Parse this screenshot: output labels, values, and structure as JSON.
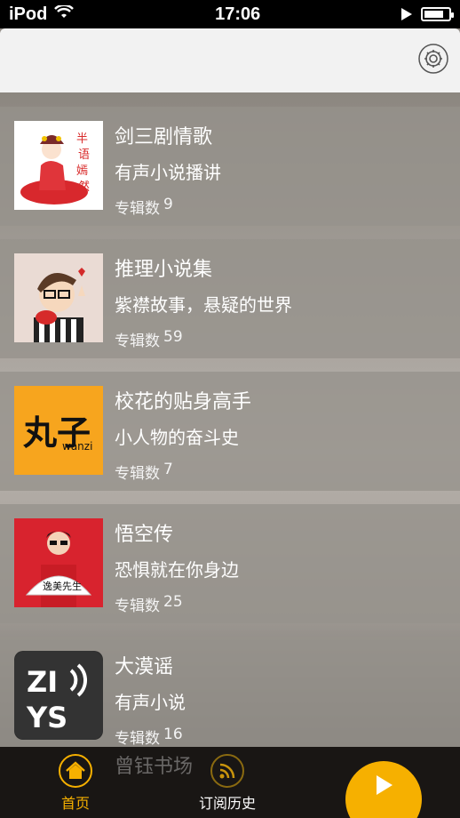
{
  "status_bar": {
    "carrier": "iPod",
    "time": "17:06"
  },
  "header": {
    "settings_icon": "gear-icon"
  },
  "items": [
    {
      "title": "剑三剧情歌",
      "subtitle": "有声小说播讲",
      "count_label": "专辑数",
      "count": "9",
      "cover_icon": "opera-girl-illustration"
    },
    {
      "title": "推理小说集",
      "subtitle": "紫襟故事，悬疑的世界",
      "count_label": "专辑数",
      "count": "59",
      "cover_icon": "cartoon-boy-illustration"
    },
    {
      "title": "校花的贴身高手",
      "subtitle": "小人物的奋斗史",
      "count_label": "专辑数",
      "count": "7",
      "cover_icon": "wanzi-logo",
      "cover_text": "丸子",
      "cover_subtext": "wanzi"
    },
    {
      "title": "悟空传",
      "subtitle": "恐惧就在你身边",
      "count_label": "专辑数",
      "count": "25",
      "cover_icon": "man-with-fan-photo"
    },
    {
      "title": "大漠谣",
      "subtitle": "有声小说",
      "count_label": "专辑数",
      "count": "16",
      "cover_icon": "zyys-logo"
    },
    {
      "title": "曾钰书场"
    }
  ],
  "tabs": [
    {
      "label": "首页",
      "icon": "home-icon",
      "active": true
    },
    {
      "label": "订阅历史",
      "icon": "rss-icon",
      "active": false
    }
  ],
  "player": {
    "icon": "play-icon"
  },
  "colors": {
    "accent": "#f6b000",
    "tab_bg": "#141210"
  }
}
